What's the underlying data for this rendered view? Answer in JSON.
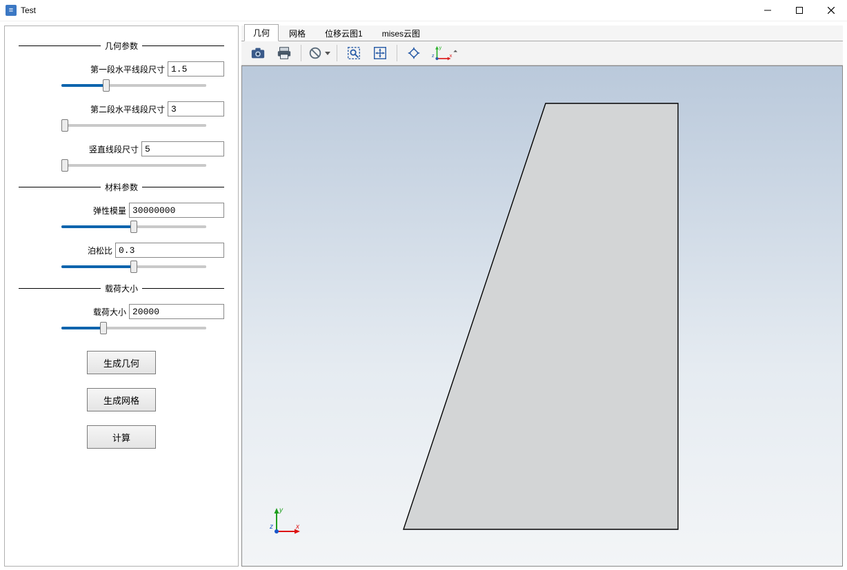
{
  "window": {
    "title": "Test"
  },
  "tabs": {
    "items": [
      "几何",
      "网格",
      "位移云图1",
      "mises云图"
    ],
    "active_index": 0
  },
  "groups": {
    "geometry": {
      "title": "几何参数",
      "p1": {
        "label": "第一段水平线段尺寸",
        "value": "1.5",
        "slider_pct": 30
      },
      "p2": {
        "label": "第二段水平线段尺寸",
        "value": "3",
        "slider_pct": 0
      },
      "p3": {
        "label": "竖直线段尺寸",
        "value": "5",
        "slider_pct": 0
      }
    },
    "material": {
      "title": "材料参数",
      "e": {
        "label": "弹性模量",
        "value": "30000000",
        "slider_pct": 50
      },
      "nu": {
        "label": "泊松比",
        "value": "0.3",
        "slider_pct": 50
      }
    },
    "load": {
      "title": "载荷大小",
      "f": {
        "label": "载荷大小",
        "value": "20000",
        "slider_pct": 28
      }
    }
  },
  "actions": {
    "gen_geom": "生成几何",
    "gen_mesh": "生成网格",
    "compute": "计算"
  },
  "axes": {
    "x": "x",
    "y": "y",
    "z": "z"
  }
}
